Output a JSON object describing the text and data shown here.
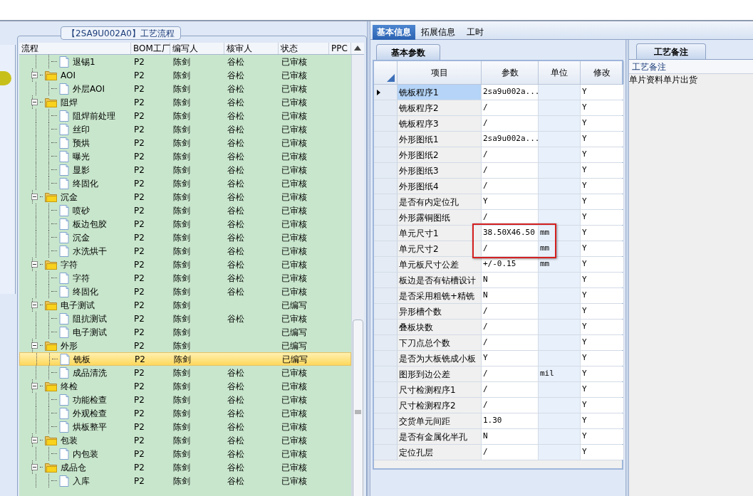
{
  "flow_panel": {
    "title": "【2SA9U002A0】工艺流程",
    "columns": [
      "流程",
      "BOM工厂",
      "编写人",
      "核审人",
      "状态",
      "PPC"
    ],
    "tree": [
      {
        "kind": "file",
        "label": "退锡1",
        "factory": "P2",
        "writer": "陈剑",
        "reviewer": "谷松",
        "status": "已审核",
        "selected": false
      },
      {
        "kind": "folder",
        "label": "AOI",
        "factory": "P2",
        "writer": "陈剑",
        "reviewer": "谷松",
        "status": "已审核",
        "selected": false,
        "expanded": true,
        "children": [
          {
            "kind": "file",
            "label": "外层AOI",
            "factory": "P2",
            "writer": "陈剑",
            "reviewer": "谷松",
            "status": "已审核",
            "selected": false
          }
        ]
      },
      {
        "kind": "folder",
        "label": "阻焊",
        "factory": "P2",
        "writer": "陈剑",
        "reviewer": "谷松",
        "status": "已审核",
        "selected": false,
        "expanded": true,
        "children": [
          {
            "kind": "file",
            "label": "阻焊前处理",
            "factory": "P2",
            "writer": "陈剑",
            "reviewer": "谷松",
            "status": "已审核",
            "selected": false
          },
          {
            "kind": "file",
            "label": "丝印",
            "factory": "P2",
            "writer": "陈剑",
            "reviewer": "谷松",
            "status": "已审核",
            "selected": false
          },
          {
            "kind": "file",
            "label": "预烘",
            "factory": "P2",
            "writer": "陈剑",
            "reviewer": "谷松",
            "status": "已审核",
            "selected": false
          },
          {
            "kind": "file",
            "label": "曝光",
            "factory": "P2",
            "writer": "陈剑",
            "reviewer": "谷松",
            "status": "已审核",
            "selected": false
          },
          {
            "kind": "file",
            "label": "显影",
            "factory": "P2",
            "writer": "陈剑",
            "reviewer": "谷松",
            "status": "已审核",
            "selected": false
          },
          {
            "kind": "file",
            "label": "终固化",
            "factory": "P2",
            "writer": "陈剑",
            "reviewer": "谷松",
            "status": "已审核",
            "selected": false
          }
        ]
      },
      {
        "kind": "folder",
        "label": "沉金",
        "factory": "P2",
        "writer": "陈剑",
        "reviewer": "谷松",
        "status": "已审核",
        "selected": false,
        "expanded": true,
        "children": [
          {
            "kind": "file",
            "label": "喷砂",
            "factory": "P2",
            "writer": "陈剑",
            "reviewer": "谷松",
            "status": "已审核",
            "selected": false
          },
          {
            "kind": "file",
            "label": "板边包胶",
            "factory": "P2",
            "writer": "陈剑",
            "reviewer": "谷松",
            "status": "已审核",
            "selected": false
          },
          {
            "kind": "file",
            "label": "沉金",
            "factory": "P2",
            "writer": "陈剑",
            "reviewer": "谷松",
            "status": "已审核",
            "selected": false
          },
          {
            "kind": "file",
            "label": "水洗烘干",
            "factory": "P2",
            "writer": "陈剑",
            "reviewer": "谷松",
            "status": "已审核",
            "selected": false
          }
        ]
      },
      {
        "kind": "folder",
        "label": "字符",
        "factory": "P2",
        "writer": "陈剑",
        "reviewer": "谷松",
        "status": "已审核",
        "selected": false,
        "expanded": true,
        "children": [
          {
            "kind": "file",
            "label": "字符",
            "factory": "P2",
            "writer": "陈剑",
            "reviewer": "谷松",
            "status": "已审核",
            "selected": false
          },
          {
            "kind": "file",
            "label": "终固化",
            "factory": "P2",
            "writer": "陈剑",
            "reviewer": "谷松",
            "status": "已审核",
            "selected": false
          }
        ]
      },
      {
        "kind": "folder",
        "label": "电子测试",
        "factory": "P2",
        "writer": "陈剑",
        "status": "已编写",
        "selected": false,
        "expanded": true,
        "children": [
          {
            "kind": "file",
            "label": "阻抗测试",
            "factory": "P2",
            "writer": "陈剑",
            "reviewer": "谷松",
            "status": "已审核",
            "selected": false
          },
          {
            "kind": "file",
            "label": "电子测试",
            "factory": "P2",
            "writer": "陈剑",
            "status": "已编写",
            "selected": false
          }
        ]
      },
      {
        "kind": "folder",
        "label": "外形",
        "factory": "P2",
        "writer": "陈剑",
        "status": "已编写",
        "selected": false,
        "expanded": true,
        "children": [
          {
            "kind": "file",
            "label": "铣板",
            "factory": "P2",
            "writer": "陈剑",
            "status": "已编写",
            "selected": true
          },
          {
            "kind": "file",
            "label": "成品清洗",
            "factory": "P2",
            "writer": "陈剑",
            "reviewer": "谷松",
            "status": "已审核",
            "selected": false
          }
        ]
      },
      {
        "kind": "folder",
        "label": "终检",
        "factory": "P2",
        "writer": "陈剑",
        "reviewer": "谷松",
        "status": "已审核",
        "selected": false,
        "expanded": true,
        "children": [
          {
            "kind": "file",
            "label": "功能检查",
            "factory": "P2",
            "writer": "陈剑",
            "reviewer": "谷松",
            "status": "已审核",
            "selected": false
          },
          {
            "kind": "file",
            "label": "外观检查",
            "factory": "P2",
            "writer": "陈剑",
            "reviewer": "谷松",
            "status": "已审核",
            "selected": false
          },
          {
            "kind": "file",
            "label": "烘板整平",
            "factory": "P2",
            "writer": "陈剑",
            "reviewer": "谷松",
            "status": "已审核",
            "selected": false
          }
        ]
      },
      {
        "kind": "folder",
        "label": "包装",
        "factory": "P2",
        "writer": "陈剑",
        "reviewer": "谷松",
        "status": "已审核",
        "selected": false,
        "expanded": true,
        "children": [
          {
            "kind": "file",
            "label": "内包装",
            "factory": "P2",
            "writer": "陈剑",
            "reviewer": "谷松",
            "status": "已审核",
            "selected": false
          }
        ]
      },
      {
        "kind": "folder",
        "label": "成品仓",
        "factory": "P2",
        "writer": "陈剑",
        "reviewer": "谷松",
        "status": "已审核",
        "selected": false,
        "expanded": true,
        "children": [
          {
            "kind": "file",
            "label": "入库",
            "factory": "P2",
            "writer": "陈剑",
            "reviewer": "谷松",
            "status": "已审核",
            "selected": false
          }
        ]
      }
    ]
  },
  "tabs": [
    {
      "label": "基本信息",
      "selected": true
    },
    {
      "label": "拓展信息",
      "selected": false
    },
    {
      "label": "工时",
      "selected": false
    }
  ],
  "params_panel": {
    "tab": "基本参数",
    "columns": [
      "项目",
      "参数",
      "单位",
      "修改"
    ],
    "rows": [
      {
        "item": "铣板程序1",
        "param": "2sa9u002a...",
        "modify": "Y",
        "selected": true
      },
      {
        "item": "铣板程序2",
        "param": "/",
        "modify": "Y",
        "selected": false
      },
      {
        "item": "铣板程序3",
        "param": "/",
        "modify": "Y",
        "selected": false
      },
      {
        "item": "外形图纸1",
        "param": "2sa9u002a...",
        "modify": "Y",
        "selected": false
      },
      {
        "item": "外形图纸2",
        "param": "/",
        "modify": "Y",
        "selected": false
      },
      {
        "item": "外形图纸3",
        "param": "/",
        "modify": "Y",
        "selected": false
      },
      {
        "item": "外形图纸4",
        "param": "/",
        "modify": "Y",
        "selected": false
      },
      {
        "item": "是否有内定位孔",
        "param": "Y",
        "modify": "Y",
        "selected": false
      },
      {
        "item": "外形露铜图纸",
        "param": "/",
        "modify": "Y",
        "selected": false
      },
      {
        "item": "单元尺寸1",
        "param": "38.50X46.50",
        "unit": "mm",
        "modify": "Y",
        "selected": false,
        "highlighted": true
      },
      {
        "item": "单元尺寸2",
        "param": "/",
        "unit": "mm",
        "modify": "Y",
        "selected": false,
        "highlighted": true
      },
      {
        "item": "单元板尺寸公差",
        "param": "+/-0.15",
        "unit": "mm",
        "modify": "Y",
        "selected": false
      },
      {
        "item": "板边是否有钻槽设计",
        "param": "N",
        "modify": "Y",
        "selected": false
      },
      {
        "item": "是否采用粗铣+精铣",
        "param": "N",
        "modify": "Y",
        "selected": false
      },
      {
        "item": "异形槽个数",
        "param": "/",
        "modify": "Y",
        "selected": false
      },
      {
        "item": "叠板块数",
        "param": "/",
        "modify": "Y",
        "selected": false
      },
      {
        "item": "下刀点总个数",
        "param": "/",
        "modify": "Y",
        "selected": false
      },
      {
        "item": "是否为大板铣成小板",
        "param": "Y",
        "modify": "Y",
        "selected": false
      },
      {
        "item": "图形到边公差",
        "param": "/",
        "unit": "mil",
        "modify": "Y",
        "selected": false
      },
      {
        "item": "尺寸检测程序1",
        "param": "/",
        "modify": "Y",
        "selected": false
      },
      {
        "item": "尺寸检测程序2",
        "param": "/",
        "modify": "Y",
        "selected": false
      },
      {
        "item": "交货单元间距",
        "param": "1.30",
        "modify": "Y",
        "selected": false
      },
      {
        "item": "是否有金属化半孔",
        "param": "N",
        "modify": "Y",
        "selected": false
      },
      {
        "item": "定位孔层",
        "param": "/",
        "modify": "Y",
        "selected": false
      }
    ]
  },
  "notes_panel": {
    "tab": "工艺备注",
    "label": "工艺备注",
    "text": "单片资料单片出货"
  }
}
